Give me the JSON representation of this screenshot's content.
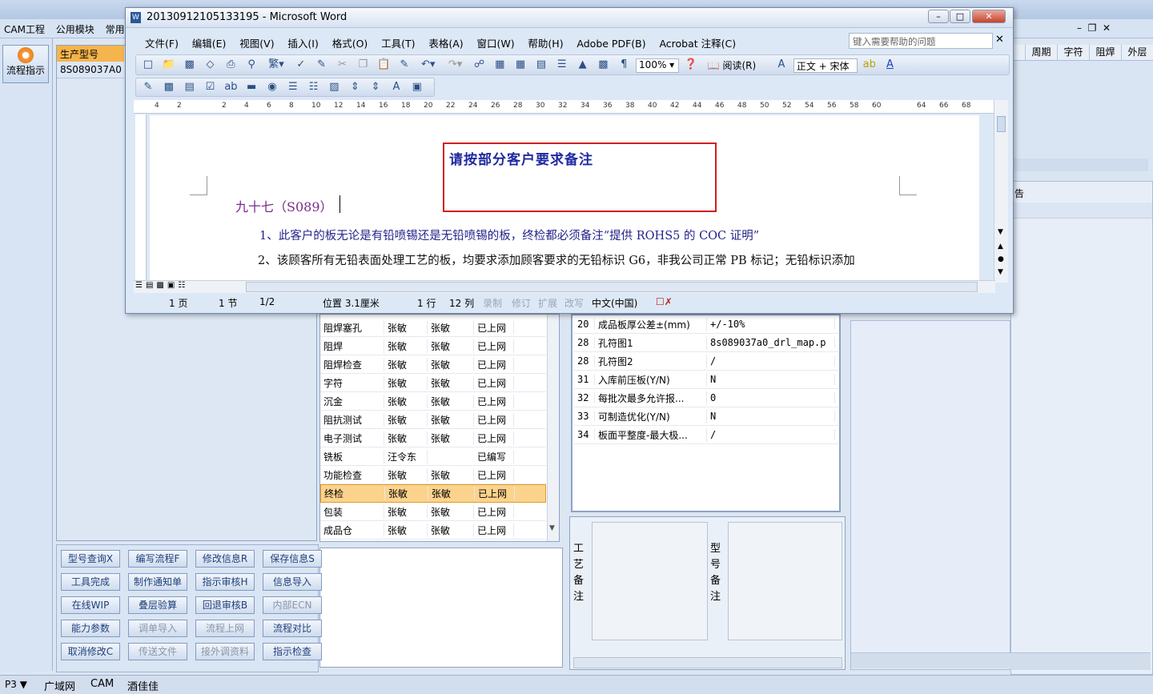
{
  "app": {
    "menu": [
      "CAM工程",
      "公用模块",
      "常用工"
    ],
    "side_button": "流程指示",
    "statusbar": [
      "P3",
      "广域网",
      "CAM",
      "酒佳佳"
    ]
  },
  "left_table": {
    "header": "生产型号",
    "rows": [
      "8S089037A0"
    ]
  },
  "right_panel": {
    "tabs": [
      "周期",
      "字符",
      "阻焊",
      "外层"
    ],
    "notice_label": "告"
  },
  "process_grid": {
    "rows": [
      [
        "阻焊塞孔",
        "张敏",
        "张敏",
        "已上网"
      ],
      [
        "阻焊",
        "张敏",
        "张敏",
        "已上网"
      ],
      [
        "阻焊检查",
        "张敏",
        "张敏",
        "已上网"
      ],
      [
        "字符",
        "张敏",
        "张敏",
        "已上网"
      ],
      [
        "沉金",
        "张敏",
        "张敏",
        "已上网"
      ],
      [
        "阻抗测试",
        "张敏",
        "张敏",
        "已上网"
      ],
      [
        "电子测试",
        "张敏",
        "张敏",
        "已上网"
      ],
      [
        "铣板",
        "汪令东",
        "",
        "已编写"
      ],
      [
        "功能检查",
        "张敏",
        "张敏",
        "已上网"
      ],
      [
        "终检",
        "张敏",
        "张敏",
        "已上网"
      ],
      [
        "包装",
        "张敏",
        "张敏",
        "已上网"
      ],
      [
        "成品仓",
        "张敏",
        "张敏",
        "已上网"
      ]
    ],
    "selected_index": 9
  },
  "param_grid": {
    "rows": [
      [
        "20",
        "成品板厚公差±(mm)",
        "+/-10%"
      ],
      [
        "28",
        "孔符图1",
        "8s089037a0_drl_map.p"
      ],
      [
        "28",
        "孔符图2",
        "/"
      ],
      [
        "31",
        "入库前压板(Y/N)",
        "N"
      ],
      [
        "32",
        "每批次最多允许报...",
        "0"
      ],
      [
        "33",
        "可制造优化(Y/N)",
        "N"
      ],
      [
        "34",
        "板面平整度-最大极...",
        "/"
      ]
    ]
  },
  "notes": {
    "process_label": "工艺备注",
    "model_label": "型号备注"
  },
  "buttons": [
    {
      "label": "型号查询X",
      "enabled": true
    },
    {
      "label": "编写流程F",
      "enabled": true
    },
    {
      "label": "修改信息R",
      "enabled": true
    },
    {
      "label": "保存信息S",
      "enabled": true
    },
    {
      "label": "工具完成",
      "enabled": true
    },
    {
      "label": "制作通知单",
      "enabled": true
    },
    {
      "label": "指示审核H",
      "enabled": true
    },
    {
      "label": "信息导入",
      "enabled": true
    },
    {
      "label": "在线WIP",
      "enabled": true
    },
    {
      "label": "叠层验算",
      "enabled": true
    },
    {
      "label": "回退审核B",
      "enabled": true
    },
    {
      "label": "内部ECN",
      "enabled": false
    },
    {
      "label": "能力参数",
      "enabled": true
    },
    {
      "label": "调单导入",
      "enabled": false
    },
    {
      "label": "流程上网",
      "enabled": false
    },
    {
      "label": "流程对比",
      "enabled": true
    },
    {
      "label": "取消修改C",
      "enabled": true
    },
    {
      "label": "传送文件",
      "enabled": false
    },
    {
      "label": "接外调资料",
      "enabled": false
    },
    {
      "label": "指示检查",
      "enabled": true
    }
  ],
  "word": {
    "title": "20130912105133195 - Microsoft Word",
    "menu": [
      "文件(F)",
      "编辑(E)",
      "视图(V)",
      "插入(I)",
      "格式(O)",
      "工具(T)",
      "表格(A)",
      "窗口(W)",
      "帮助(H)",
      "Adobe PDF(B)",
      "Acrobat 注释(C)"
    ],
    "help_placeholder": "键入需要帮助的问题",
    "zoom": "100%",
    "read_btn": "阅读(R)",
    "style": "正文 + 宋体",
    "ruler_nums": [
      "4",
      "2",
      "2",
      "4",
      "6",
      "8",
      "10",
      "12",
      "14",
      "16",
      "18",
      "20",
      "22",
      "24",
      "26",
      "28",
      "30",
      "32",
      "34",
      "36",
      "38",
      "40",
      "42",
      "44",
      "46",
      "48",
      "50",
      "52",
      "54",
      "56",
      "58",
      "60",
      "64",
      "66",
      "68"
    ],
    "doc_box_text": "请按部分客户要求备注",
    "doc_heading": "九十七（S089）",
    "doc_line1": "1、此客户的板无论是有铅喷锡还是无铅喷锡的板，终检都必须备注“提供 ROHS5 的 COC 证明”",
    "doc_line2": "2、该顾客所有无铅表面处理工艺的板，均要求添加顾客要求的无铅标识 G6，非我公司正常 PB 标记；无铅标识添加",
    "status": [
      "1 页",
      "1 节",
      "1/2",
      "位置 3.1厘米",
      "1 行",
      "12 列",
      "录制",
      "修订",
      "扩展",
      "改写",
      "中文(中国)"
    ]
  }
}
